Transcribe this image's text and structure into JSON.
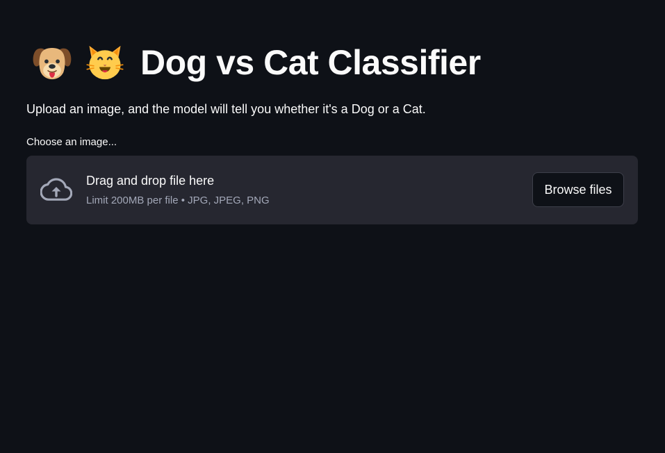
{
  "header": {
    "title": "Dog vs Cat Classifier",
    "title_icons": [
      "dog-face-emoji",
      "cat-face-emoji"
    ]
  },
  "description": "Upload an image, and the model will tell you whether it's a Dog or a Cat.",
  "uploader": {
    "label": "Choose an image...",
    "drop_text": "Drag and drop file here",
    "limit_text": "Limit 200MB per file • JPG, JPEG, PNG",
    "browse_label": "Browse files",
    "icon": "cloud-upload-icon"
  },
  "colors": {
    "background": "#0e1117",
    "dropzone": "#262730",
    "text": "#fafafa",
    "muted_text": "#a3a8b8"
  }
}
